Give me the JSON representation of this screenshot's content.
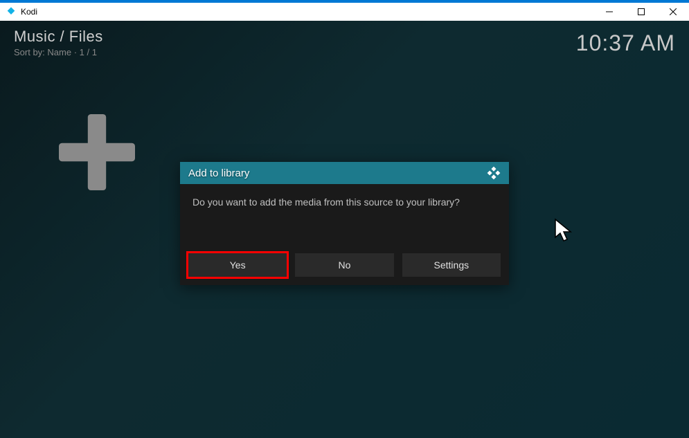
{
  "window": {
    "title": "Kodi"
  },
  "header": {
    "breadcrumb": "Music / Files",
    "sort_label": "Sort by: Name",
    "pagination": "1 / 1"
  },
  "clock": "10:37 AM",
  "dialog": {
    "title": "Add to library",
    "message": "Do you want to add the media from this source to your library?",
    "buttons": {
      "yes": "Yes",
      "no": "No",
      "settings": "Settings"
    }
  }
}
